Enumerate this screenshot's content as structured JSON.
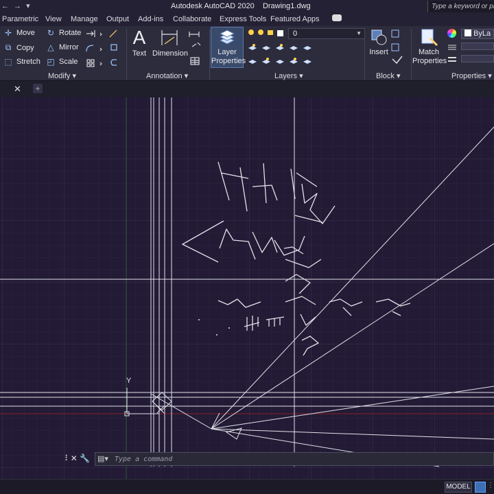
{
  "titlebar": {
    "qat": "← → ▾",
    "app_title": "Autodesk AutoCAD 2020",
    "doc_title": "Drawing1.dwg",
    "search_placeholder": "Type a keyword or phrase"
  },
  "tabs": [
    "Parametric",
    "View",
    "Manage",
    "Output",
    "Add-ins",
    "Collaborate",
    "Express Tools",
    "Featured Apps"
  ],
  "ribbon": {
    "modify": {
      "items": [
        {
          "icon": "move-icon",
          "glyph": "✛",
          "label": "Move"
        },
        {
          "icon": "rotate-icon",
          "glyph": "↻",
          "label": "Rotate"
        },
        {
          "icon": "copy-icon",
          "glyph": "⧉",
          "label": "Copy"
        },
        {
          "icon": "mirror-icon",
          "glyph": "△",
          "label": "Mirror"
        },
        {
          "icon": "stretch-icon",
          "glyph": "⬚",
          "label": "Stretch"
        },
        {
          "icon": "scale-icon",
          "glyph": "◰",
          "label": "Scale"
        }
      ],
      "panel_label": "Modify ▾"
    },
    "annotation": {
      "text_label": "Text",
      "dimension_label": "Dimension",
      "panel_label": "Annotation ▾"
    },
    "layers": {
      "layer_properties_label": "Layer Properties",
      "current_layer": "0",
      "panel_label": "Layers ▾"
    },
    "block": {
      "insert_label": "Insert",
      "panel_label": "Block ▾"
    },
    "properties": {
      "match_label": "Match Properties",
      "bylayer": "ByLa",
      "panel_label": "Properties ▾"
    }
  },
  "doc_tabs": {
    "close": "✕",
    "new": "+"
  },
  "ucs": {
    "y_label": "Y"
  },
  "command": {
    "controls": "⠇✕ 🔧",
    "prompt_icon": "▤▾",
    "placeholder": "Type a command"
  },
  "status": {
    "model": "MODEL"
  },
  "colors": {
    "canvas_bg": "#231b35",
    "grid_minor": "#2c2442",
    "grid_major": "#3a3155",
    "line": "#e2e2ea",
    "accent": "#3d6fb5",
    "red_axis": "#8a1f2a",
    "green_axis": "#2e5a3a"
  }
}
